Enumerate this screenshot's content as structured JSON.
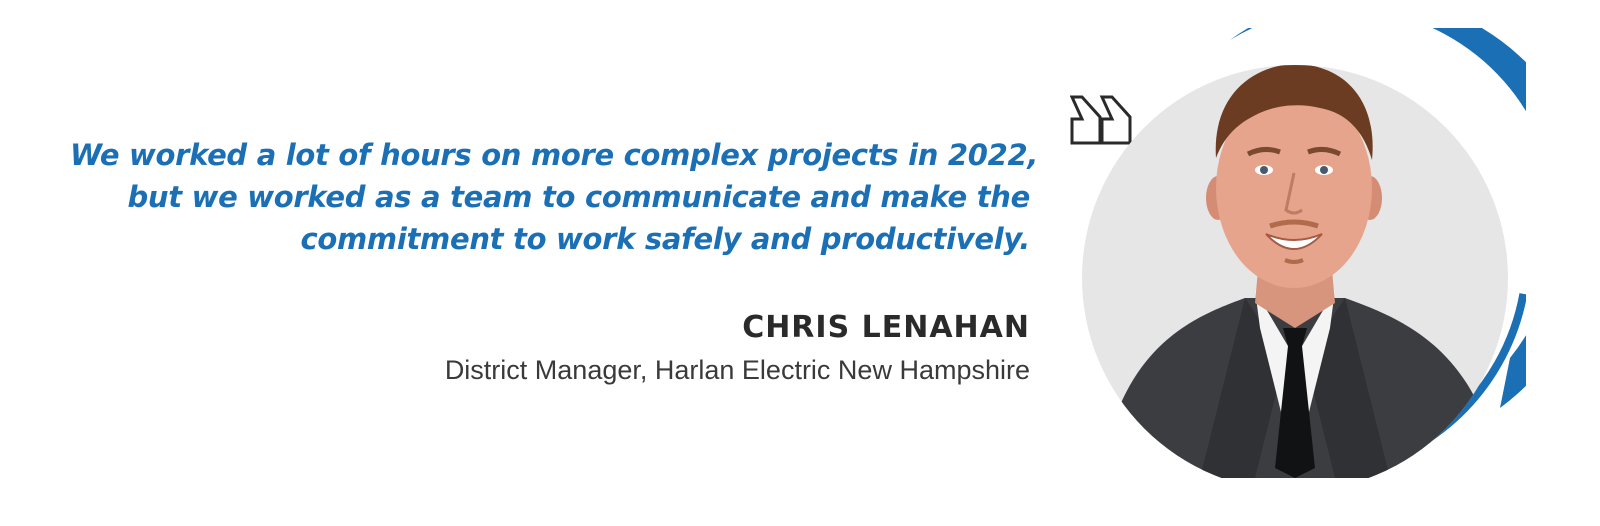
{
  "quote": {
    "lines": [
      "We worked a lot of hours on more complex projects in 2022,",
      "but we worked as a team to communicate and make the",
      "commitment to work safely and productively."
    ]
  },
  "author": {
    "name": "CHRIS LENAHAN",
    "title": "District Manager, Harlan Electric New Hampshire"
  },
  "icons": {
    "quote_mark": "closing-quote-icon",
    "portrait": "person-portrait"
  },
  "colors": {
    "accent": "#1b6fb5",
    "name": "#2a2a2a",
    "title": "#3a3a3a",
    "portrait_bg": "#e6e6e6",
    "suit": "#3b3d40"
  }
}
